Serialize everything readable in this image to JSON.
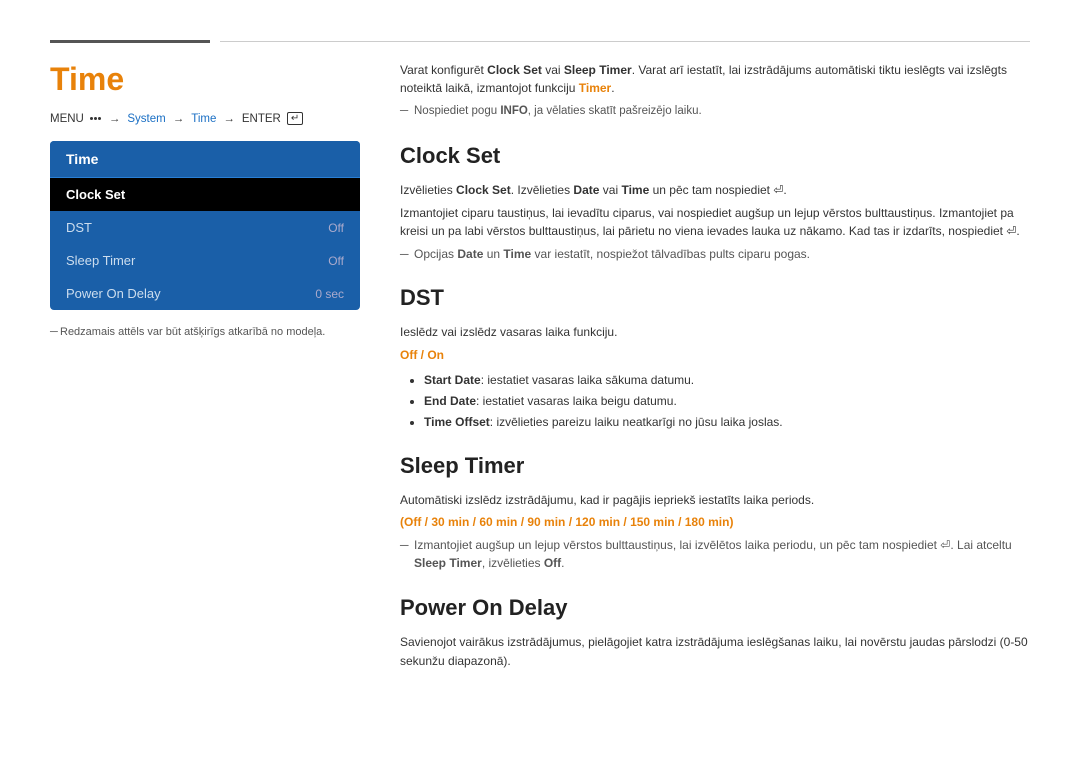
{
  "page": {
    "title": "Time",
    "top_line": true,
    "breadcrumb": {
      "parts": [
        "MENU",
        "→",
        "System",
        "→",
        "Time",
        "→",
        "ENTER"
      ]
    }
  },
  "menu": {
    "title": "Time",
    "items": [
      {
        "label": "Clock Set",
        "value": "",
        "selected": true
      },
      {
        "label": "DST",
        "value": "Off",
        "selected": false
      },
      {
        "label": "Sleep Timer",
        "value": "Off",
        "selected": false
      },
      {
        "label": "Power On Delay",
        "value": "0 sec",
        "selected": false
      }
    ]
  },
  "left_note": "Redzamais attēls var būt atšķirīgs atkarībā no modeļa.",
  "right": {
    "intro": "Varat konfigurēt Clock Set vai Sleep Timer. Varat arī iestatīt, lai izstrādājums automātiski tiktu ieslēgts vai izslēgts noteiktā laikā, izmantojot funkciju Timer.",
    "intro_note": "Nospiediet pogu INFO, ja vēlaties skatīt pašreizējo laiku.",
    "sections": [
      {
        "id": "clock-set",
        "title": "Clock Set",
        "paragraphs": [
          "Izvēlieties Clock Set. Izvēlieties Date vai Time un pēc tam nospiediet ⏎.",
          "Izmantojiet ciparu taustiņus, lai ievadītu ciparus, vai nospiediet augšup un lejup vērstos bulttaustiņus. Izmantojiet pa kreisi un pa labi vērstos bulttaustiņus, lai pārietu no viena ievades lauka uz nākamo. Kad tas ir izdarīts, nospiediet ⏎.",
          "Opcijas Date un Time var iestatīt, nospiežot tālvadības pults ciparu pogas."
        ],
        "note": null
      },
      {
        "id": "dst",
        "title": "DST",
        "paragraphs": [
          "Ieslēdz vai izslēdz vasaras laika funkciju."
        ],
        "orange_line": "Off / On",
        "bullets": [
          "Start Date: iestatiet vasaras laika sākuma datumu.",
          "End Date: iestatiet vasaras laika beigu datumu.",
          "Time Offset: izvēlieties pareizu laiku neatkarīgi no jūsu laika joslas."
        ],
        "note": null
      },
      {
        "id": "sleep-timer",
        "title": "Sleep Timer",
        "paragraphs": [
          "Automātiski izslēdz izstrādājumu, kad ir pagājis iepriekš iestatīts laika periods."
        ],
        "orange_options": "(Off / 30 min / 60 min / 90 min / 120 min / 150 min / 180 min)",
        "note": "Izmantojiet augšup un lejup vērstos bulttaustiņus, lai izvēlētos laika periodu, un pēc tam nospiediet ⏎. Lai atceltu Sleep Timer, izvēlieties Off."
      },
      {
        "id": "power-on-delay",
        "title": "Power On Delay",
        "paragraphs": [
          "Savienojot vairākus izstrādājumus, pielāgojiet katra izstrādājuma ieslēgšanas laiku, lai novērstu jaudas pārslodzi (0-50 sekunžu diapazonā)."
        ],
        "note": null
      }
    ]
  }
}
